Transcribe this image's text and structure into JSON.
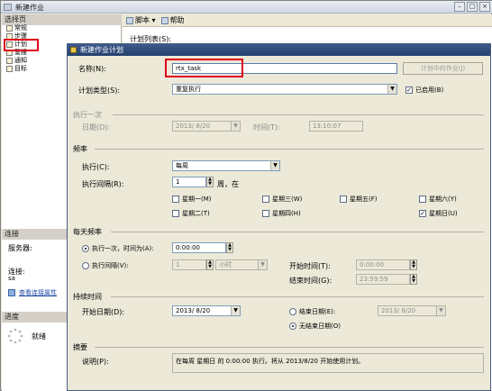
{
  "window": {
    "title": "新建作业"
  },
  "left": {
    "pages_header": "选择页",
    "pages": [
      "常规",
      "步骤",
      "计划",
      "警报",
      "通知",
      "目标"
    ],
    "connection_header": "连接",
    "server_label": "服务器:",
    "connection_label": "连接:",
    "connection_value": "sa",
    "view_conn_link": "查看连接属性",
    "progress_header": "进度",
    "progress_status": "就绪"
  },
  "right": {
    "toolbar": {
      "script": "脚本",
      "help": "帮助"
    },
    "schedule_list_label": "计划列表(S):"
  },
  "dialog": {
    "title": "新建作业计划",
    "name_label": "名称(N):",
    "name_value": "rtx_task",
    "jobs_in_schedule_button": "计划中的作业(J)",
    "schedule_type_label": "计划类型(S):",
    "schedule_type_value": "重复执行",
    "enabled_label": "已启用(B)",
    "one_time": {
      "header": "执行一次",
      "date_label": "日期(D):",
      "date_value": "2013/ 8/20",
      "time_label": "时间(T):",
      "time_value": "13:10:07"
    },
    "frequency": {
      "header": "频率",
      "occurs_label": "执行(C):",
      "occurs_value": "每周",
      "recurs_label": "执行间隔(R):",
      "recurs_value": "1",
      "recurs_suffix": "周，在",
      "days": [
        {
          "label": "星期一(M)",
          "checked": false
        },
        {
          "label": "星期三(W)",
          "checked": false
        },
        {
          "label": "星期五(F)",
          "checked": false
        },
        {
          "label": "星期六(Y)",
          "checked": false
        },
        {
          "label": "星期二(T)",
          "checked": false
        },
        {
          "label": "星期四(H)",
          "checked": false
        },
        {
          "label": "星期日(U)",
          "checked": true
        }
      ]
    },
    "daily": {
      "header": "每天频率",
      "once_label": "执行一次，时间为(A):",
      "once_value": "0:00:00",
      "every_label": "执行间隔(V):",
      "every_value": "1",
      "every_unit": "小时",
      "start_label": "开始时间(T):",
      "start_value": "0:00:00",
      "end_label": "结束时间(G):",
      "end_value": "23:59:59"
    },
    "duration": {
      "header": "持续时间",
      "start_date_label": "开始日期(D):",
      "start_date_value": "2013/ 8/20",
      "end_date_label": "结束日期(E):",
      "end_date_value": "2013/ 8/20",
      "no_end_label": "无结束日期(O)"
    },
    "summary": {
      "header": "摘要",
      "desc_label": "说明(P):",
      "desc_value": "在每周 星期日 的 0:00:00 执行。将从 2013/8/20 开始使用计划。"
    }
  },
  "colors": {
    "highlight": "#e0001b",
    "title_blue": "#23406e"
  }
}
